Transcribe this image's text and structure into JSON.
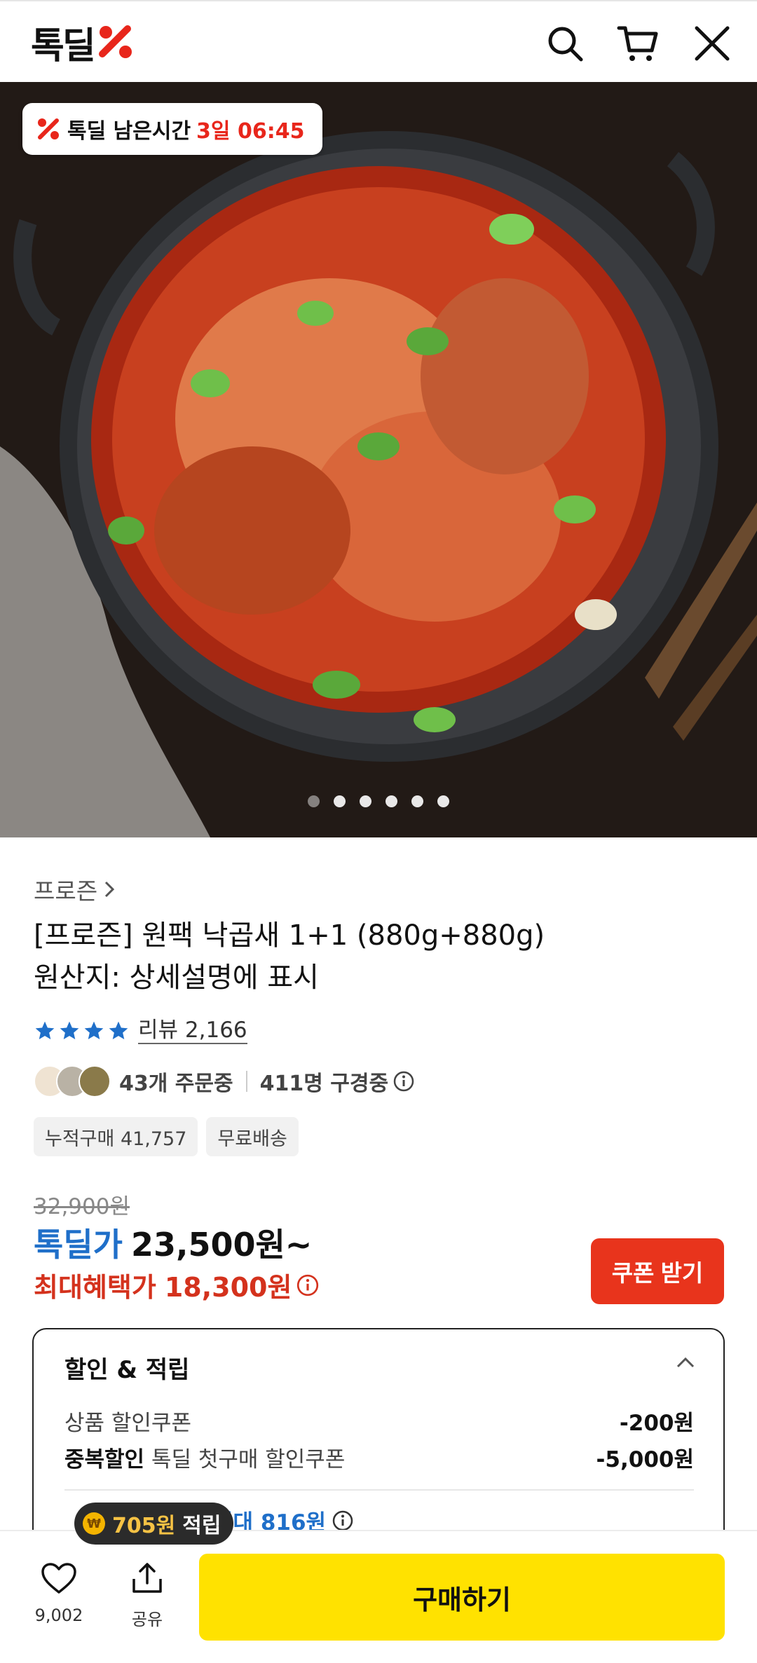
{
  "header": {
    "logo_text": "톡딜",
    "icons": [
      "search-icon",
      "cart-icon",
      "close-icon"
    ]
  },
  "hero": {
    "timer_label": "톡딜 남은시간",
    "timer_remaining": "3일 06:45",
    "image_count": 6,
    "active_index": 0
  },
  "product": {
    "category": "프로즌",
    "title_line1": "[프로즌] 원팩 낙곱새 1+1 (880g+880g)",
    "title_line2": "원산지: 상세설명에 표시",
    "rating_stars": 4,
    "review_label": "리뷰 2,166",
    "orders_text": "43개 주문중",
    "viewers_text": "411명 구경중",
    "tags": [
      "누적구매 41,757",
      "무료배송"
    ]
  },
  "price": {
    "original": "32,900원",
    "deal_label": "톡딜가",
    "deal_value": "23,500원~",
    "max_label": "최대혜택가",
    "max_value": "18,300원",
    "coupon_button": "쿠폰 받기"
  },
  "discount": {
    "title": "할인 & 적립",
    "row1_name": "상품 할인쿠폰",
    "row1_amount": "-200원",
    "row2_bold": "중복할인",
    "row2_name": "톡딜 첫구매 할인쿠폰",
    "row2_amount": "-5,000원",
    "partial_text": "최대 816원"
  },
  "points": {
    "coin_symbol": "₩",
    "amount": "705원",
    "text": "적립"
  },
  "bottom": {
    "like_count": "9,002",
    "share_label": "공유",
    "buy_button": "구매하기"
  },
  "colors": {
    "brand_red": "#e8261b",
    "deal_blue": "#1f6fc9",
    "benefit_red": "#d4321d",
    "buy_yellow": "#ffe200",
    "star_blue": "#1f6fc9"
  }
}
